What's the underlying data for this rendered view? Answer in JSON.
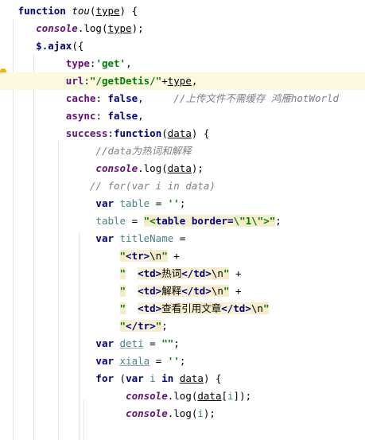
{
  "editor": {
    "lines": [
      [
        {
          "t": "function",
          "c": "kw"
        },
        {
          "t": " "
        },
        {
          "t": "tou",
          "c": "fn"
        },
        {
          "t": "("
        },
        {
          "t": "type",
          "c": "param"
        },
        {
          "t": ") {"
        }
      ],
      [
        {
          "t": "console",
          "c": "console"
        },
        {
          "t": "."
        },
        {
          "t": "log"
        },
        {
          "t": "("
        },
        {
          "t": "type",
          "c": "param"
        },
        {
          "t": ");"
        }
      ],
      [
        {
          "t": "$",
          "c": "kw"
        },
        {
          "t": ".",
          "c": "kw"
        },
        {
          "t": "ajax",
          "c": "kw"
        },
        {
          "t": "({"
        }
      ],
      [
        {
          "t": "type",
          "c": "prop"
        },
        {
          "t": ":"
        },
        {
          "t": "'get'",
          "c": "str"
        },
        {
          "t": ","
        }
      ],
      [
        {
          "t": "url",
          "c": "prop"
        },
        {
          "t": ":"
        },
        {
          "t": "\"/getDetis/\"",
          "c": "str"
        },
        {
          "t": "+"
        },
        {
          "t": "type",
          "c": "param"
        },
        {
          "t": ","
        }
      ],
      [
        {
          "t": "cache",
          "c": "prop"
        },
        {
          "t": ": "
        },
        {
          "t": "false",
          "c": "kw"
        },
        {
          "t": ",     "
        },
        {
          "t": "//上传文件不需缓存 鸿雁hotWorld",
          "c": "cmt"
        }
      ],
      [
        {
          "t": "async",
          "c": "prop"
        },
        {
          "t": ": "
        },
        {
          "t": "false",
          "c": "kw"
        },
        {
          "t": ","
        }
      ],
      [
        {
          "t": "success",
          "c": "prop"
        },
        {
          "t": ":"
        },
        {
          "t": "function",
          "c": "kw"
        },
        {
          "t": "("
        },
        {
          "t": "data",
          "c": "param"
        },
        {
          "t": ") {"
        }
      ],
      [
        {
          "t": "//data为热词和解释",
          "c": "cmt"
        }
      ],
      [
        {
          "t": "console",
          "c": "console"
        },
        {
          "t": "."
        },
        {
          "t": "log"
        },
        {
          "t": "("
        },
        {
          "t": "data",
          "c": "param"
        },
        {
          "t": ");"
        }
      ],
      [
        {
          "t": "// for(var i in data)",
          "c": "cmt"
        }
      ],
      [
        {
          "t": "var",
          "c": "kw"
        },
        {
          "t": " "
        },
        {
          "t": "table",
          "c": "id"
        },
        {
          "t": " = "
        },
        {
          "t": "''",
          "c": "str"
        },
        {
          "t": ";"
        }
      ],
      [
        {
          "t": "table",
          "c": "id"
        },
        {
          "t": " = "
        },
        {
          "t": "\"",
          "c": "str strbg"
        },
        {
          "t": "<",
          "c": "str strbg"
        },
        {
          "t": "table",
          "c": "tag tagbg"
        },
        {
          "t": " border=",
          "c": "tag tagbg"
        },
        {
          "t": "\\\"1\\\"",
          "c": "str strbg"
        },
        {
          "t": ">",
          "c": "str strbg"
        },
        {
          "t": "\"",
          "c": "str strbg"
        },
        {
          "t": ";"
        }
      ],
      [
        {
          "t": "var",
          "c": "kw"
        },
        {
          "t": " "
        },
        {
          "t": "titleName",
          "c": "id"
        },
        {
          "t": " ="
        }
      ],
      [
        {
          "t": "\"",
          "c": "str strbg"
        },
        {
          "t": "<tr>",
          "c": "tag tagbg"
        },
        {
          "t": "\\n",
          "c": "plain strbg"
        },
        {
          "t": "\"",
          "c": "str strbg"
        },
        {
          "t": " +"
        }
      ],
      [
        {
          "t": "\"",
          "c": "str strbg"
        },
        {
          "t": "  "
        },
        {
          "t": "<td>",
          "c": "tag tagbg"
        },
        {
          "t": "热词",
          "c": "plain strbg"
        },
        {
          "t": "</td>",
          "c": "tag tagbg"
        },
        {
          "t": "\\n",
          "c": "plain strbg"
        },
        {
          "t": "\"",
          "c": "str strbg"
        },
        {
          "t": " +"
        }
      ],
      [
        {
          "t": "\"",
          "c": "str strbg"
        },
        {
          "t": "  "
        },
        {
          "t": "<td>",
          "c": "tag tagbg"
        },
        {
          "t": "解释",
          "c": "plain strbg"
        },
        {
          "t": "</td>",
          "c": "tag tagbg"
        },
        {
          "t": "\\n",
          "c": "plain strbg"
        },
        {
          "t": "\"",
          "c": "str strbg"
        },
        {
          "t": " +"
        }
      ],
      [
        {
          "t": "\"",
          "c": "str strbg"
        },
        {
          "t": "  "
        },
        {
          "t": "<td>",
          "c": "tag tagbg"
        },
        {
          "t": "查看引用文章",
          "c": "plain strbg"
        },
        {
          "t": "</td>",
          "c": "tag tagbg"
        },
        {
          "t": "\\n",
          "c": "plain strbg"
        },
        {
          "t": "\"",
          "c": "str strbg"
        }
      ],
      [
        {
          "t": "\"",
          "c": "str strbg"
        },
        {
          "t": "</tr>",
          "c": "tag tagbg"
        },
        {
          "t": "\"",
          "c": "str strbg"
        },
        {
          "t": ";"
        }
      ],
      [
        {
          "t": "var",
          "c": "kw"
        },
        {
          "t": " "
        },
        {
          "t": "deti",
          "c": "id warn"
        },
        {
          "t": " = "
        },
        {
          "t": "\"\"",
          "c": "str"
        },
        {
          "t": ";"
        }
      ],
      [
        {
          "t": "var",
          "c": "kw"
        },
        {
          "t": " "
        },
        {
          "t": "xiala",
          "c": "id warn"
        },
        {
          "t": " = "
        },
        {
          "t": "''",
          "c": "str"
        },
        {
          "t": ";"
        }
      ],
      [
        {
          "t": "for",
          "c": "kw"
        },
        {
          "t": " ("
        },
        {
          "t": "var",
          "c": "kw"
        },
        {
          "t": " "
        },
        {
          "t": "i",
          "c": "id"
        },
        {
          "t": " "
        },
        {
          "t": "in",
          "c": "kw"
        },
        {
          "t": " "
        },
        {
          "t": "data",
          "c": "param"
        },
        {
          "t": ") {"
        }
      ],
      [
        {
          "t": "console",
          "c": "console"
        },
        {
          "t": "."
        },
        {
          "t": "log"
        },
        {
          "t": "("
        },
        {
          "t": "data",
          "c": "param"
        },
        {
          "t": "["
        },
        {
          "t": "i",
          "c": "id"
        },
        {
          "t": "]);"
        }
      ],
      [
        {
          "t": "console",
          "c": "console"
        },
        {
          "t": "."
        },
        {
          "t": "log"
        },
        {
          "t": "("
        },
        {
          "t": "i",
          "c": "id"
        },
        {
          "t": ");"
        }
      ]
    ]
  }
}
